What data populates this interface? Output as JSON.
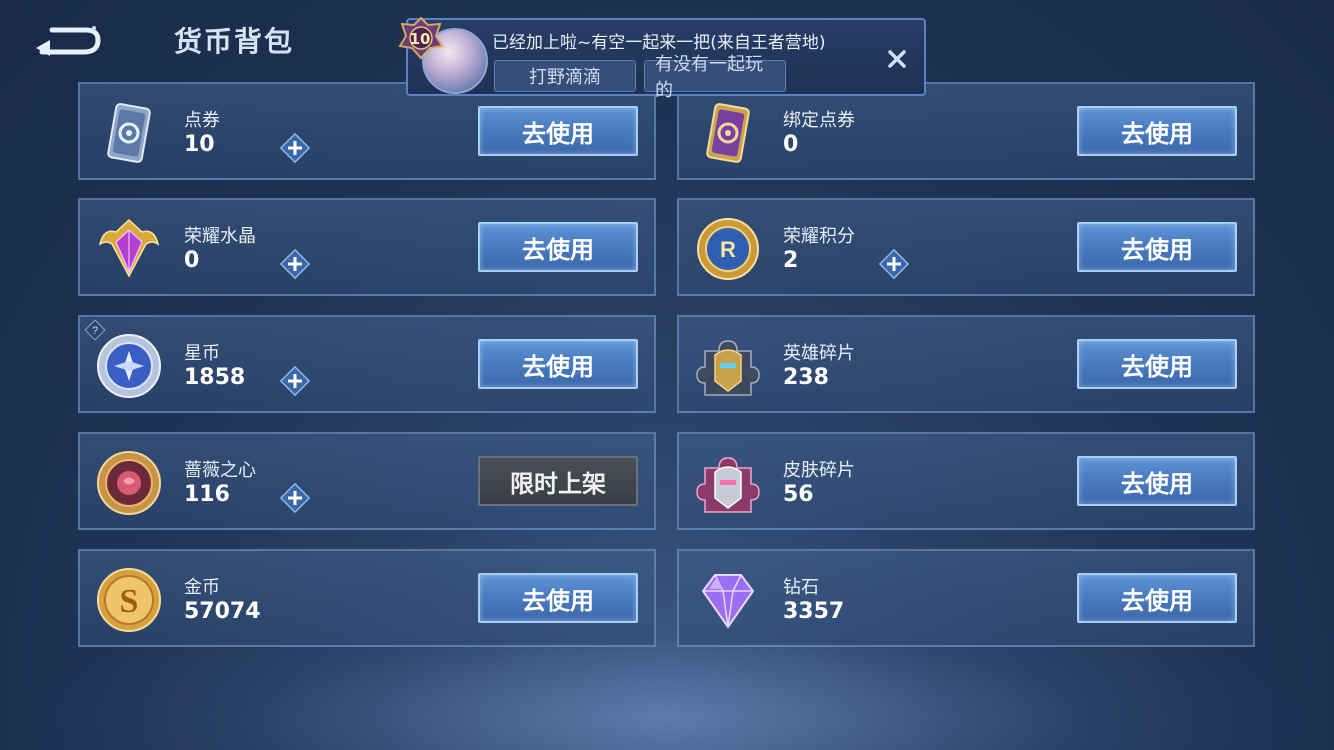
{
  "header": {
    "title": "货币背包"
  },
  "notification": {
    "level": "10",
    "message": "已经加上啦~有空一起来一把(来自王者营地)",
    "chips": [
      "打野滴滴",
      "有没有一起玩的"
    ]
  },
  "items": [
    {
      "name": "点券",
      "value": "10",
      "button": "去使用",
      "has_plus": true,
      "icon": "coupon-icon"
    },
    {
      "name": "绑定点券",
      "value": "0",
      "button": "去使用",
      "has_plus": false,
      "icon": "bound-coupon-icon"
    },
    {
      "name": "荣耀水晶",
      "value": "0",
      "button": "去使用",
      "has_plus": true,
      "icon": "glory-crystal-icon"
    },
    {
      "name": "荣耀积分",
      "value": "2",
      "button": "去使用",
      "has_plus": true,
      "icon": "glory-points-icon"
    },
    {
      "name": "星币",
      "value": "1858",
      "button": "去使用",
      "has_plus": true,
      "icon": "star-coin-icon"
    },
    {
      "name": "英雄碎片",
      "value": "238",
      "button": "去使用",
      "has_plus": false,
      "icon": "hero-fragment-icon"
    },
    {
      "name": "蔷薇之心",
      "value": "116",
      "button": "限时上架",
      "has_plus": true,
      "icon": "rose-heart-icon"
    },
    {
      "name": "皮肤碎片",
      "value": "56",
      "button": "去使用",
      "has_plus": false,
      "icon": "skin-fragment-icon"
    },
    {
      "name": "金币",
      "value": "57074",
      "button": "去使用",
      "has_plus": false,
      "icon": "gold-coin-icon"
    },
    {
      "name": "钻石",
      "value": "3357",
      "button": "去使用",
      "has_plus": false,
      "icon": "diamond-icon"
    }
  ],
  "colors": {
    "accent": "#4a7cc2",
    "card_border": "#7aa0d2",
    "disabled": "#3a3e44"
  }
}
